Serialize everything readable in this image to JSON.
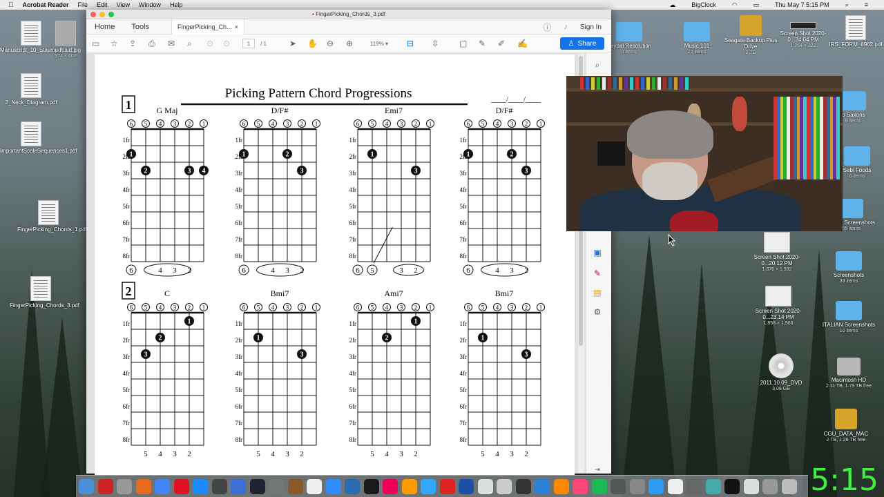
{
  "menubar": {
    "app": "Acrobat Reader",
    "menus": [
      "File",
      "Edit",
      "View",
      "Window",
      "Help"
    ],
    "right_items": [
      "BigClock",
      "Thu May 7  5:15 PM"
    ]
  },
  "window": {
    "title": "FingerPicking_Chords_3.pdf",
    "nav_tabs": [
      "Home",
      "Tools"
    ],
    "doc_tab": "FingerPicking_Ch...",
    "doc_tab_close": "×",
    "sign_in": "Sign In",
    "share": "Share",
    "page_current": "1",
    "page_total": "/  1",
    "zoom": "119%"
  },
  "sheet": {
    "title": "Picking Pattern Chord Progressions",
    "date_blank": "____/____/____",
    "section1": "1",
    "section2": "2",
    "strings": [
      "6",
      "5",
      "4",
      "3",
      "2",
      "1"
    ],
    "frets": [
      "1fr",
      "2fr",
      "3fr",
      "4fr",
      "5fr",
      "6fr",
      "7fr",
      "8fr"
    ],
    "row1": [
      {
        "name": "G Maj",
        "bottom": [
          "6",
          "4",
          "3",
          "2"
        ]
      },
      {
        "name": "D/F#",
        "bottom": [
          "6",
          "4",
          "3",
          "2"
        ]
      },
      {
        "name": "Emi7",
        "bottom": [
          "6",
          "5",
          "3",
          "2"
        ]
      },
      {
        "name": "D/F#",
        "bottom": [
          "6",
          "4",
          "3",
          "2"
        ]
      }
    ],
    "row2": [
      {
        "name": "C",
        "bottom": [
          "5",
          "4",
          "3",
          "2"
        ]
      },
      {
        "name": "Bmi7",
        "bottom": [
          "5",
          "4",
          "3",
          "2"
        ]
      },
      {
        "name": "Ami7",
        "bottom": [
          "5",
          "4",
          "3",
          "2"
        ]
      },
      {
        "name": "Bmi7",
        "bottom": [
          "5",
          "4",
          "3",
          "2"
        ]
      }
    ]
  },
  "desktop_left": [
    {
      "label": "Manuscript_10_Stave.pdf"
    },
    {
      "label": "mermaid.jpg",
      "sub": "374 × 602"
    },
    {
      "label": "2_Neck_Diagram.pdf"
    },
    {
      "label": "ImportantScaleSequences1.pdf"
    },
    {
      "label": "FingerPicking_Chords_1.pdf"
    },
    {
      "label": "FingerPicking_Chords_3.pdf"
    }
  ],
  "desktop_right": [
    {
      "label": "Keypal Resolution",
      "sub": "8 items"
    },
    {
      "label": "Music 101",
      "sub": "22 items"
    },
    {
      "label": "Seagate Backup Plus Drive",
      "sub": "2 TB"
    },
    {
      "label": "Screen Shot 2020-0...24.04 PM",
      "sub": "1,264 × 322"
    },
    {
      "label": "IRS_FORM_8962.pdf"
    },
    {
      "label": "lo Saxons",
      "sub": "9 items"
    },
    {
      "label": "Sebi Foods",
      "sub": "6 items"
    },
    {
      "label": "Recent Screenshots",
      "sub": "155 items"
    },
    {
      "label": "Screen Shot 2020-0...20.12 PM",
      "sub": "1,876 × 1,592"
    },
    {
      "label": "Screenshots",
      "sub": "33 items"
    },
    {
      "label": "Screen Shot 2020-0...23.14 PM",
      "sub": "1,858 × 1,566"
    },
    {
      "label": "ITALIAN Screenshots",
      "sub": "10 items"
    },
    {
      "label": "2011.10.09_DVD",
      "sub": "3.08 GB"
    },
    {
      "label": "Macintosh HD",
      "sub": "2.11 TB, 1.79 TB free"
    },
    {
      "label": "CGU_DATA_MAC",
      "sub": "2 TB, 1.26 TB free"
    }
  ],
  "big_clock": "5:15",
  "colors": {
    "accent": "#1473e6",
    "clock": "#3ff03c"
  }
}
